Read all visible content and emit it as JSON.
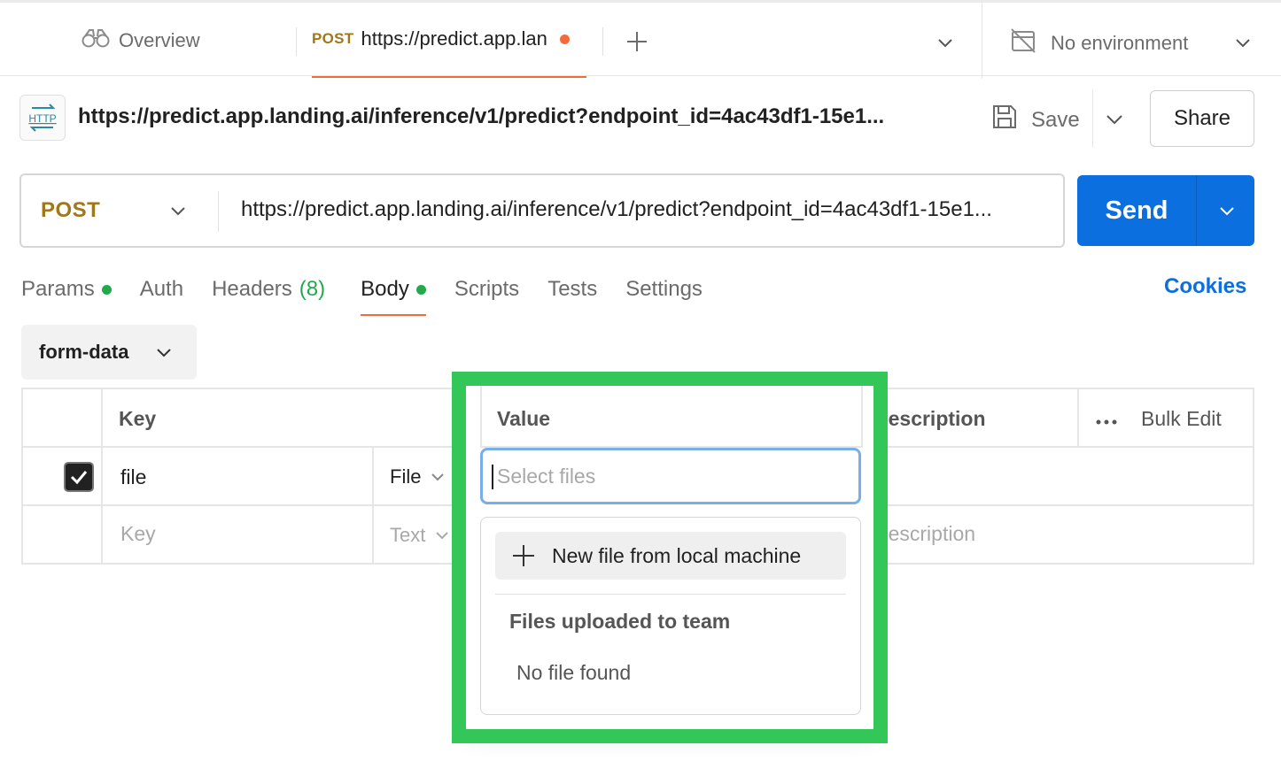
{
  "tabs": {
    "overview_label": "Overview",
    "active_method": "POST",
    "active_name": "https://predict.app.lan",
    "environment": "No environment"
  },
  "request": {
    "title": "https://predict.app.landing.ai/inference/v1/predict?endpoint_id=4ac43df1-15e1...",
    "save_label": "Save",
    "share_label": "Share",
    "method": "POST",
    "url": "https://predict.app.landing.ai/inference/v1/predict?endpoint_id=4ac43df1-15e1...",
    "send_label": "Send"
  },
  "subtabs": {
    "params": "Params",
    "auth": "Auth",
    "headers": "Headers",
    "headers_count": "(8)",
    "body": "Body",
    "scripts": "Scripts",
    "tests": "Tests",
    "settings": "Settings",
    "cookies": "Cookies"
  },
  "body_type": "form-data",
  "table": {
    "headers": {
      "key": "Key",
      "value": "Value",
      "description": "Description",
      "bulk_edit": "Bulk Edit"
    },
    "rows": [
      {
        "key": "file",
        "type": "File",
        "checked": true
      },
      {
        "key_placeholder": "Key",
        "type": "Text",
        "description_placeholder": "Description"
      }
    ]
  },
  "file_picker": {
    "placeholder": "Select files",
    "new_file_label": "New file from local machine",
    "section_title": "Files uploaded to team",
    "empty_text": "No file found"
  },
  "colors": {
    "method": "#a0781a",
    "send": "#0b6fdf",
    "highlight": "#33c658",
    "active_tab_underline": "#f26b3a",
    "status_dot": "#22a94b"
  }
}
